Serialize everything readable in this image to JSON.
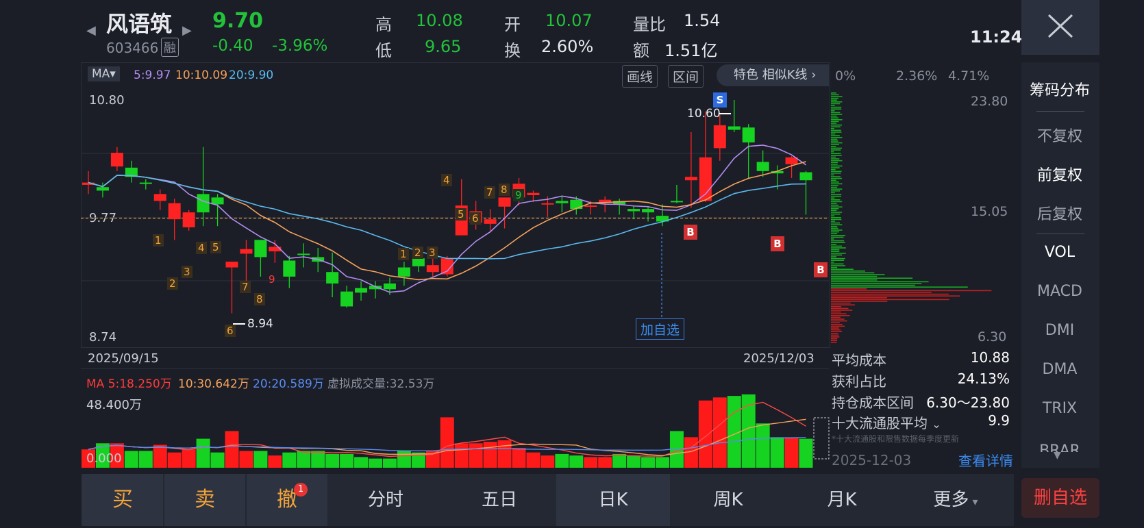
{
  "header": {
    "stock_name": "风语筑",
    "stock_code": "603466",
    "margin_tag": "融",
    "price": "9.70",
    "change": "-0.40",
    "change_pct": "-3.96%",
    "high_label": "高",
    "high": "10.08",
    "low_label": "低",
    "low": "9.65",
    "open_label": "开",
    "open": "10.07",
    "turnover_label": "换",
    "turnover": "2.60%",
    "vol_ratio_label": "量比",
    "vol_ratio": "1.54",
    "amount_label": "额",
    "amount": "1.51亿",
    "time": "11:24"
  },
  "toolbar": {
    "ma_label": "MA",
    "ma5": "5:9.97",
    "ma10": "10:10.09",
    "ma20": "20:9.90",
    "draw_line": "画线",
    "interval": "区间",
    "feature": "特色",
    "similar_k": "相似K线 ›"
  },
  "chip_header": {
    "p0": "0%",
    "p1": "2.36%",
    "p2": "4.71%"
  },
  "chart_labels": {
    "price_top": "10.80",
    "price_mid": "9.77",
    "price_bottom": "8.74",
    "date_start": "2025/09/15",
    "date_end": "2025/12/03",
    "high_mark": "10.60",
    "low_mark": "8.94",
    "add_watch": "加自选",
    "chip_top": "23.80",
    "chip_mid": "15.05",
    "chip_bottom": "6.30",
    "s_tag": "S",
    "b_tag": "B"
  },
  "volume": {
    "ma_label": "MA 5:18.250万",
    "ma10": "10:30.642万",
    "ma20": "20:20.589万",
    "virtual": "虚拟成交量:32.53万",
    "top": "48.400万",
    "bottom": "0.000"
  },
  "chip_info": {
    "avg_cost_label": "平均成本",
    "avg_cost": "10.88",
    "profit_label": "获利占比",
    "profit": "24.13%",
    "range_label": "持仓成本区间",
    "range": "6.30～23.80",
    "top10_label": "十大流通股平均",
    "top10": "9.9",
    "note": "*十大流通股和限售数据每季度更新",
    "date": "2025-12-03",
    "detail": "查看详情"
  },
  "right_menu": [
    "筹码分布",
    "不复权",
    "前复权",
    "后复权",
    "VOL",
    "MACD",
    "DMI",
    "DMA",
    "TRIX",
    "BRAR"
  ],
  "bottom": {
    "buy": "买",
    "sell": "卖",
    "cancel": "撤",
    "cancel_badge": "1",
    "tabs": [
      "分时",
      "五日",
      "日K",
      "周K",
      "月K",
      "更多"
    ],
    "remove_watch": "删自选"
  },
  "chart_data": {
    "type": "candlestick",
    "ylim": [
      8.74,
      10.8
    ],
    "candles": [
      [
        10.06,
        10.08,
        10.18,
        9.98
      ],
      [
        10.04,
        10.01,
        10.08,
        9.95
      ],
      [
        10.22,
        10.34,
        10.39,
        10.18
      ],
      [
        10.21,
        10.13,
        10.27,
        10.08
      ],
      [
        10.08,
        10.07,
        10.11,
        10.02
      ],
      [
        9.92,
        9.98,
        10.02,
        9.84
      ],
      [
        9.76,
        9.9,
        9.94,
        9.58
      ],
      [
        9.69,
        9.82,
        9.84,
        9.66
      ],
      [
        9.98,
        9.82,
        10.39,
        9.7
      ],
      [
        9.95,
        9.89,
        9.98,
        9.7
      ],
      [
        9.34,
        9.39,
        9.39,
        8.94
      ],
      [
        9.46,
        9.5,
        9.58,
        9.22
      ],
      [
        9.58,
        9.43,
        9.58,
        9.26
      ],
      [
        9.48,
        9.52,
        9.58,
        9.38
      ],
      [
        9.4,
        9.26,
        9.44,
        9.16
      ],
      [
        9.46,
        9.45,
        9.55,
        9.34
      ],
      [
        9.43,
        9.39,
        9.51,
        9.3
      ],
      [
        9.3,
        9.2,
        9.47,
        9.08
      ],
      [
        9.13,
        9.0,
        9.18,
        8.99
      ],
      [
        9.16,
        9.12,
        9.22,
        9.05
      ],
      [
        9.18,
        9.15,
        9.22,
        9.07
      ],
      [
        9.2,
        9.15,
        9.25,
        9.1
      ],
      [
        9.34,
        9.26,
        9.39,
        9.18
      ],
      [
        9.42,
        9.35,
        9.43,
        9.3
      ],
      [
        9.3,
        9.36,
        9.45,
        9.26
      ],
      [
        9.28,
        9.42,
        9.44,
        9.26
      ],
      [
        9.62,
        9.88,
        10.11,
        9.62
      ],
      [
        9.73,
        9.83,
        9.92,
        9.67
      ],
      [
        9.72,
        9.76,
        9.85,
        9.66
      ],
      [
        9.87,
        9.95,
        9.95,
        9.68
      ],
      [
        9.95,
        10.07,
        10.12,
        9.88
      ],
      [
        9.97,
        9.99,
        10.01,
        9.91
      ],
      [
        9.9,
        9.9,
        9.96,
        9.78
      ],
      [
        9.92,
        9.9,
        9.96,
        9.82
      ],
      [
        9.93,
        9.85,
        9.96,
        9.8
      ],
      [
        9.88,
        9.88,
        9.92,
        9.8
      ],
      [
        9.91,
        9.93,
        9.96,
        9.82
      ],
      [
        9.92,
        9.89,
        9.94,
        9.8
      ],
      [
        9.85,
        9.83,
        9.88,
        9.76
      ],
      [
        9.85,
        9.82,
        9.87,
        9.74
      ],
      [
        9.79,
        9.74,
        9.89,
        9.7
      ],
      [
        9.92,
        9.91,
        10.06,
        9.9
      ],
      [
        10.1,
        10.13,
        10.52,
        9.86
      ],
      [
        9.92,
        10.3,
        10.7,
        9.91
      ],
      [
        10.38,
        10.58,
        10.67,
        10.27
      ],
      [
        10.57,
        10.54,
        10.8,
        10.52
      ],
      [
        10.56,
        10.43,
        10.59,
        10.11
      ],
      [
        10.26,
        10.18,
        10.36,
        10.13
      ],
      [
        10.18,
        10.16,
        10.23,
        10.02
      ],
      [
        10.24,
        10.3,
        10.31,
        10.12
      ],
      [
        10.17,
        10.1,
        10.18,
        9.8
      ]
    ],
    "volume": [
      12,
      16,
      16,
      11,
      11,
      15,
      10,
      12,
      19,
      10,
      24,
      11,
      11,
      8,
      10,
      11,
      11,
      9,
      9,
      7,
      6,
      6,
      11,
      10,
      11,
      33,
      16,
      16,
      17,
      18,
      13,
      10,
      8,
      9,
      8,
      7,
      7,
      9,
      8,
      7,
      7,
      24,
      20,
      44,
      46,
      47,
      48,
      29,
      20,
      20,
      19
    ]
  }
}
